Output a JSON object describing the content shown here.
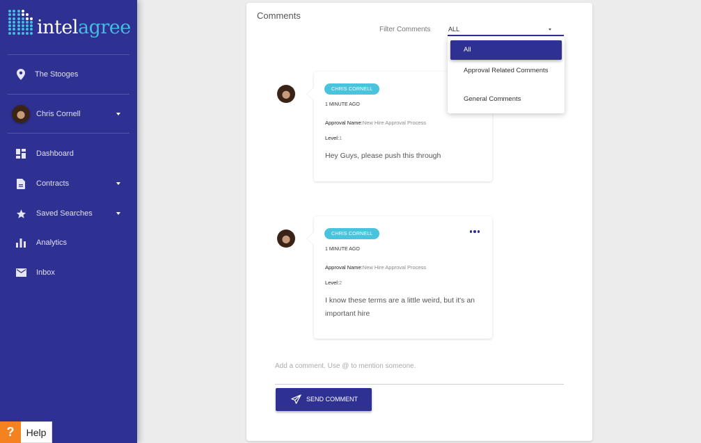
{
  "brand": {
    "logo_part1": "intel",
    "logo_part2": "agree",
    "primary_color": "#2e3192",
    "accent_color": "#45bde0"
  },
  "sidebar": {
    "organization": {
      "icon": "location-pin-icon",
      "label": "The Stooges"
    },
    "user": {
      "name": "Chris Cornell",
      "icon": "chevron-down-icon"
    },
    "items": [
      {
        "label": "Dashboard",
        "icon": "dashboard-icon",
        "has_caret": false
      },
      {
        "label": "Contracts",
        "icon": "document-icon",
        "has_caret": true
      },
      {
        "label": "Saved Searches",
        "icon": "star-icon",
        "has_caret": true
      },
      {
        "label": "Analytics",
        "icon": "bar-chart-icon",
        "has_caret": false
      },
      {
        "label": "Inbox",
        "icon": "mail-icon",
        "has_caret": false
      }
    ],
    "help": {
      "icon_text": "?",
      "label": "Help"
    }
  },
  "comments_panel": {
    "title": "Comments",
    "filter_label": "Filter Comments",
    "filter_value": "ALL",
    "filter_options": [
      "All",
      "Approval Related Comments",
      "General Comments"
    ],
    "selected_option": "All",
    "comments": [
      {
        "author": "CHRIS CORNELL",
        "time": "1 MINUTE AGO",
        "approval_label": "Approval Name:",
        "approval_value": "New Hire Approval Process",
        "level_label": "Level:",
        "level_value": "1",
        "text": "Hey Guys, please push this through",
        "has_menu": false
      },
      {
        "author": "CHRIS CORNELL",
        "time": "1 MINUTE AGO",
        "approval_label": "Approval Name:",
        "approval_value": "New Hire Approval Process",
        "level_label": "Level:",
        "level_value": "2",
        "text": "I know these terms are a little weird, but it's an important hire",
        "has_menu": true
      }
    ],
    "input_placeholder": "Add a comment. Use @ to mention someone.",
    "send_label": "SEND COMMENT"
  }
}
